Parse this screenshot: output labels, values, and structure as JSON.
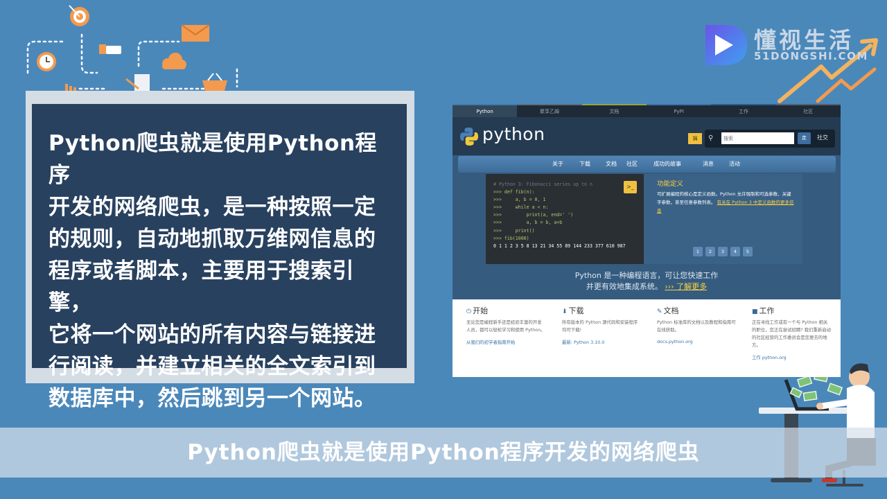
{
  "text_box": {
    "lines": [
      "Python爬虫就是使用Python程序",
      "开发的网络爬虫，是一种按照一定",
      "的规则，自动地抓取万维网信息的",
      "程序或者脚本，主要用于搜索引擎，",
      "它将一个网站的所有内容与链接进",
      "行阅读，并建立相关的全文索引到",
      "数据库中，然后跳到另一个网站。"
    ]
  },
  "logo": {
    "cn": "懂视生活",
    "en": "51DONGSHI.COM"
  },
  "screenshot": {
    "top_nav": [
      "Python",
      "聚享乙姆",
      "文档",
      "PyPI",
      "工作",
      "社区"
    ],
    "brand": "python",
    "donate": "捐",
    "search_placeholder": "搜索",
    "go": "走",
    "social": "社交",
    "main_nav": [
      "关于",
      "下载",
      "文档",
      "社区",
      "成功的故事",
      "消息",
      "活动"
    ],
    "code": {
      "comment": "# Python 3: Fibonacci series up to n",
      "lines": [
        ">>> def fib(n):",
        ">>>     a, b = 0, 1",
        ">>>     while a < n:",
        ">>>         print(a, end=' ')",
        ">>>         a, b = b, a+b",
        ">>>     print()",
        ">>> fib(1000)"
      ],
      "output": "0 1 1 2 3 5 8 13 21 34 55 89 144 233 377 610 987"
    },
    "launch": ">_",
    "feature": {
      "title": "功能定义",
      "body": "可扩展编程的核心是定义函数。Python 允许强制和可选参数、关键字参数，甚至任意参数列表。",
      "link": "有关在 Python 3 中定义函数的更多信息"
    },
    "pager": [
      "1",
      "2",
      "3",
      "4",
      "5"
    ],
    "intro": {
      "line1": "Python 是一种编程语言，可让您快速工作",
      "line2": "并更有效地集成系统。",
      "more": "››› 了解更多"
    },
    "widgets": [
      {
        "icon": "⏻",
        "title": "开始",
        "body": "无论您是编程新手还是经验丰富的开发人员，都可以轻松学习和使用 Python。",
        "link": "从我们的初学者指南开始"
      },
      {
        "icon": "⬇",
        "title": "下载",
        "body": "所有版本的 Python 源代码和安装程序均可下载!",
        "link": "最新: Python 3.10.0"
      },
      {
        "icon": "✎",
        "title": "文档",
        "body": "Python 标准库的文档以及教程和指南可在线获取。",
        "link": "docs.python.org"
      },
      {
        "icon": "■",
        "title": "工作",
        "body": "正在寻找工作或有一个与 Python 相关的职位，您正在尝试招聘? 我们重新启动的社区经营的工作委员会是您要去的地方。",
        "link": "工作 python.org"
      }
    ]
  },
  "subtitle": "Python爬虫就是使用Python程序开发的网络爬虫"
}
